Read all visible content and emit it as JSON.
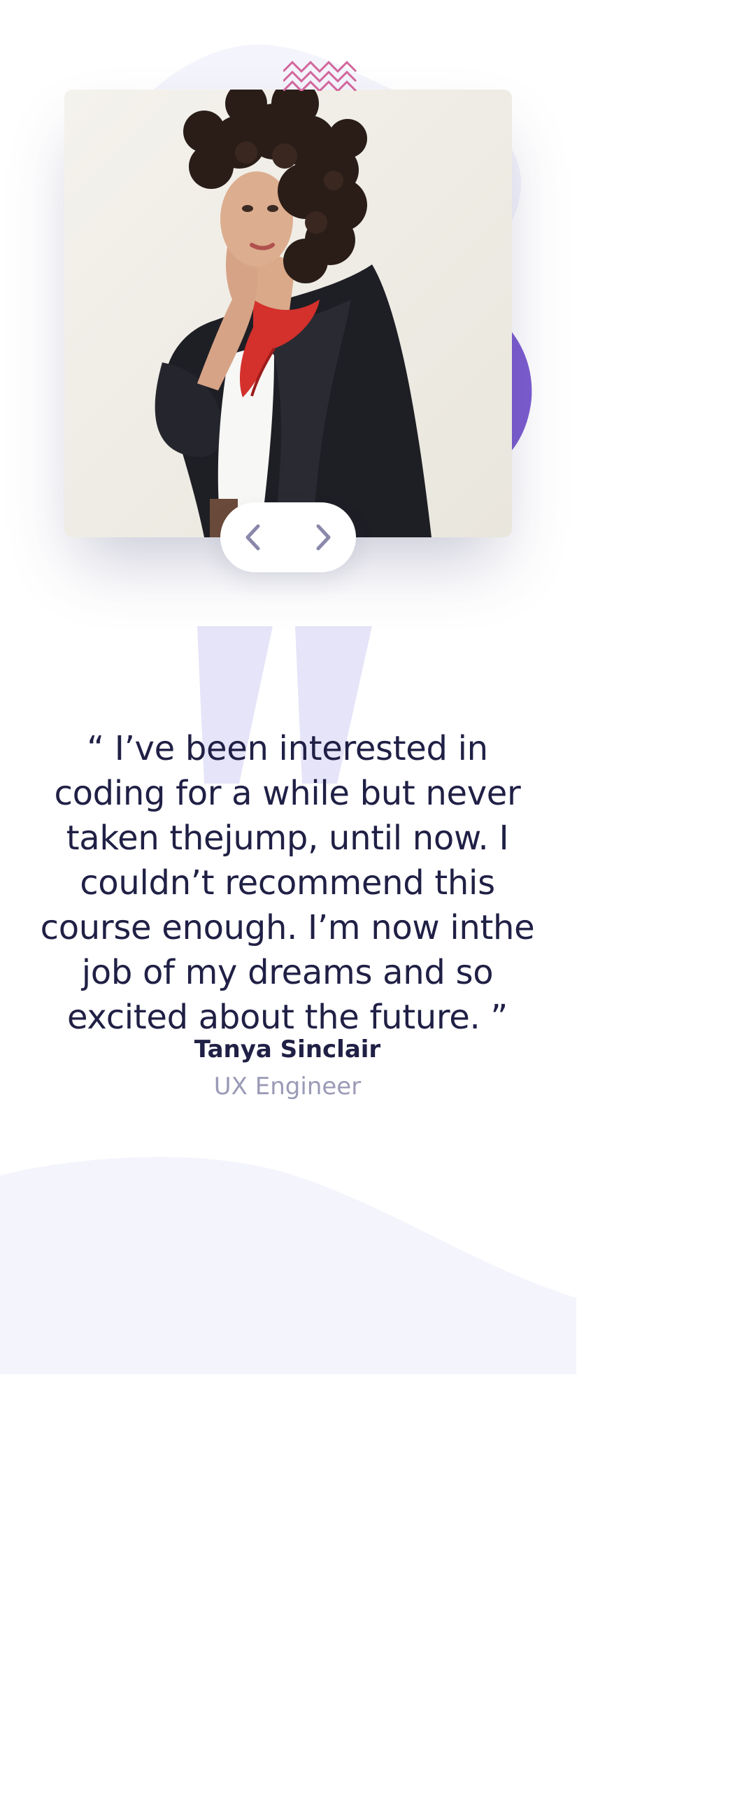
{
  "testimonial": {
    "quote": "“ I’ve been interested in coding for a while but never taken thejump, until now. I couldn’t recommend this course enough. I’m now inthe job of my dreams and so excited about the future. ”",
    "name": "Tanya Sinclair",
    "role": "UX Engineer"
  },
  "navigation": {
    "prev_icon": "chevron-left-icon",
    "next_icon": "chevron-right-icon"
  },
  "colors": {
    "heading_text": "#202046",
    "muted_text": "#9b9ab7",
    "accent_purple": "#7c5cd0",
    "pattern_pink": "#d2669b",
    "soft_background": "#f4f4fc",
    "nav_icon": "#8a88aa"
  }
}
